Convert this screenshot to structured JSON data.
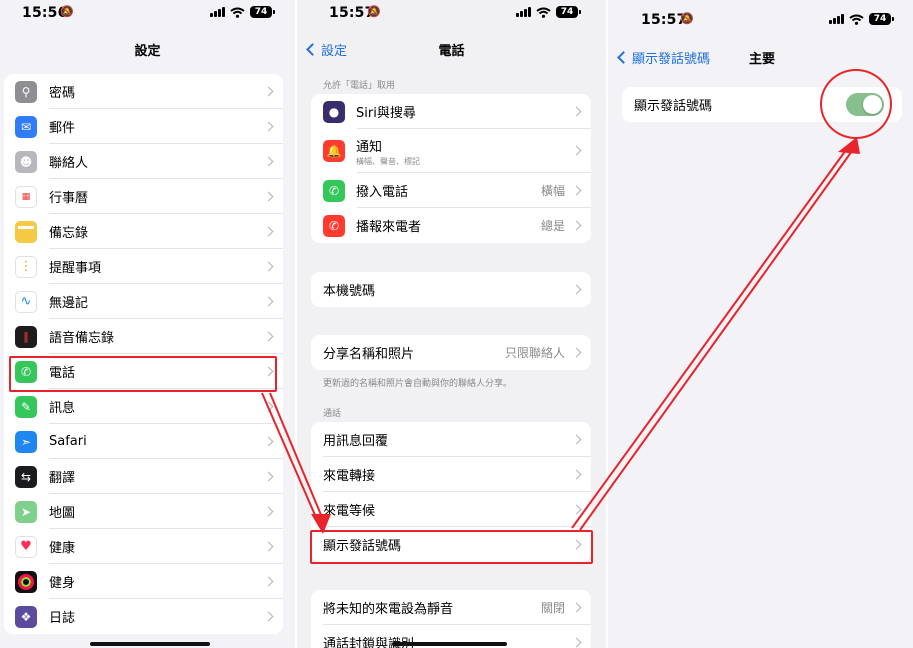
{
  "screen1": {
    "time": "15:56",
    "battery": "74",
    "title": "設定",
    "items": [
      {
        "label": "密碼",
        "icon": "key-icon",
        "color": "#8e8e93"
      },
      {
        "label": "郵件",
        "icon": "mail-icon",
        "color": "#2f7cf6"
      },
      {
        "label": "聯絡人",
        "icon": "contacts-icon",
        "color": "#b8b8bc"
      },
      {
        "label": "行事曆",
        "icon": "calendar-icon",
        "color": "#ffffff"
      },
      {
        "label": "備忘錄",
        "icon": "notes-icon",
        "color": "#f6c945"
      },
      {
        "label": "提醒事項",
        "icon": "reminders-icon",
        "color": "#ffffff"
      },
      {
        "label": "無邊記",
        "icon": "freeform-icon",
        "color": "#ffffff"
      },
      {
        "label": "語音備忘錄",
        "icon": "voice-memos-icon",
        "color": "#1c1c1e"
      },
      {
        "label": "電話",
        "icon": "phone-icon",
        "color": "#34c759"
      },
      {
        "label": "訊息",
        "icon": "messages-icon",
        "color": "#34c759"
      },
      {
        "label": "Safari",
        "icon": "safari-icon",
        "color": "#1e88f0"
      },
      {
        "label": "翻譯",
        "icon": "translate-icon",
        "color": "#1c1c1e"
      },
      {
        "label": "地圖",
        "icon": "maps-icon",
        "color": "#7ed08a"
      },
      {
        "label": "健康",
        "icon": "health-icon",
        "color": "#ffffff"
      },
      {
        "label": "健身",
        "icon": "fitness-icon",
        "color": "#111111"
      },
      {
        "label": "日誌",
        "icon": "journal-icon",
        "color": "#5b4a9e"
      }
    ]
  },
  "screen2": {
    "time": "15:57",
    "battery": "74",
    "back_label": "設定",
    "title": "電話",
    "allow_header": "允許「電話」取用",
    "allow_items": [
      {
        "label": "Siri與搜尋",
        "icon": "siri-icon",
        "value": ""
      },
      {
        "label": "通知",
        "sub": "橫幅、聲音、標記",
        "icon": "notifications-icon",
        "value": ""
      },
      {
        "label": "撥入電話",
        "icon": "incoming-call-icon",
        "value": "橫幅"
      },
      {
        "label": "播報來電者",
        "icon": "announce-calls-icon",
        "value": "總是"
      }
    ],
    "my_number": "本機號碼",
    "share_name": {
      "label": "分享名稱和照片",
      "value": "只限聯絡人"
    },
    "share_caption": "更新過的名稱和照片會自動與你的聯絡人分享。",
    "calls_header": "通話",
    "calls_items": [
      {
        "label": "用訊息回覆",
        "value": ""
      },
      {
        "label": "來電轉接",
        "value": ""
      },
      {
        "label": "來電等候",
        "value": ""
      },
      {
        "label": "顯示發話號碼",
        "value": ""
      }
    ],
    "bottom_items": [
      {
        "label": "將未知的來電設為靜音",
        "value": "關閉"
      },
      {
        "label": "通話封鎖與識別",
        "value": ""
      }
    ]
  },
  "screen3": {
    "time": "15:57",
    "battery": "74",
    "back_label": "顯示發話號碼",
    "title": "主要",
    "toggle_label": "顯示發話號碼",
    "toggle_on": true
  },
  "colors": {
    "accent": "#1f6fe0",
    "highlight": "#e8232a",
    "toggle_on": "#87bf8e"
  }
}
